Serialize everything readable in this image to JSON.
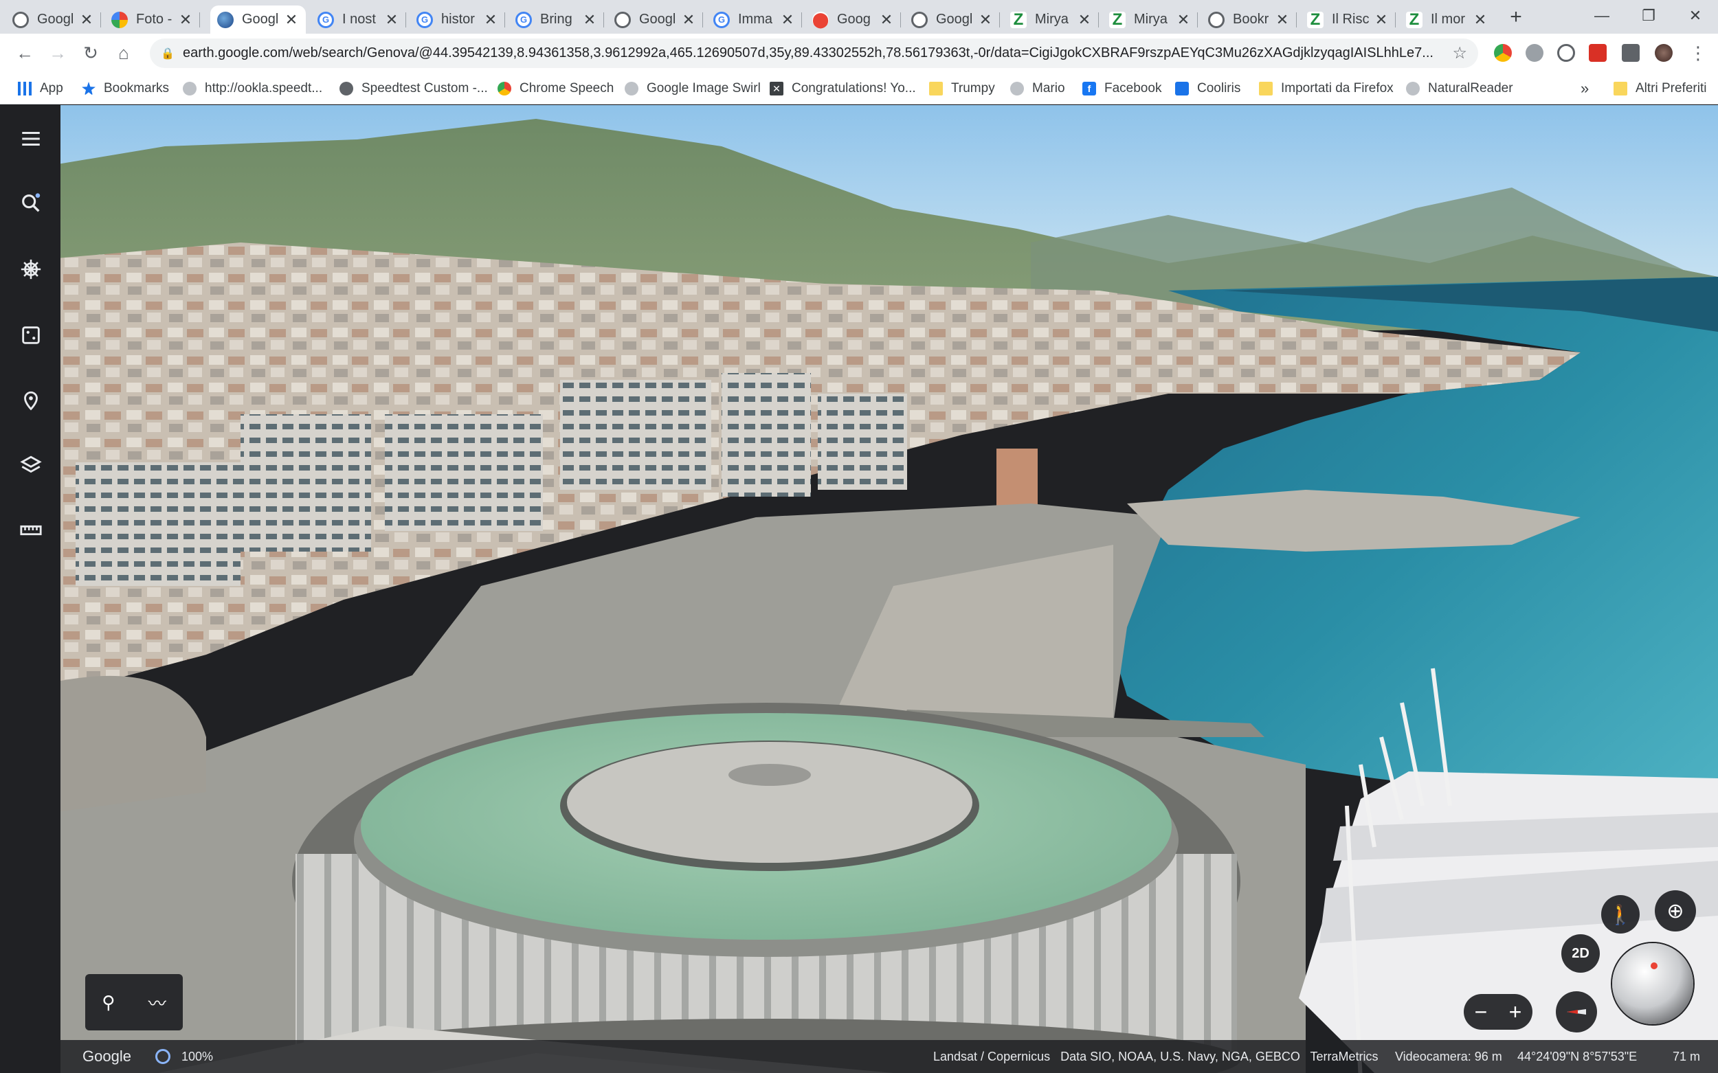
{
  "tabs": [
    {
      "title": "Googl",
      "icon": "google-icon",
      "active": false
    },
    {
      "title": "Foto -",
      "icon": "google-photos-icon",
      "active": false
    },
    {
      "title": "Googl",
      "icon": "google-earth-icon",
      "active": true
    },
    {
      "title": "I nost",
      "icon": "google-icon",
      "active": false
    },
    {
      "title": "histor",
      "icon": "google-icon",
      "active": false
    },
    {
      "title": "Bring",
      "icon": "google-icon",
      "active": false
    },
    {
      "title": "Googl",
      "icon": "globe-icon",
      "active": false
    },
    {
      "title": "Imma",
      "icon": "google-icon",
      "active": false
    },
    {
      "title": "Goog",
      "icon": "google-maps-icon",
      "active": false
    },
    {
      "title": "Googl",
      "icon": "globe-icon",
      "active": false
    },
    {
      "title": "Mirya",
      "icon": "miryam-icon",
      "active": false
    },
    {
      "title": "Mirya",
      "icon": "miryam-icon",
      "active": false
    },
    {
      "title": "Bookr",
      "icon": "globe-icon",
      "active": false
    },
    {
      "title": "Il Risc",
      "icon": "miryam-icon",
      "active": false
    },
    {
      "title": "Il mor",
      "icon": "miryam-icon",
      "active": false
    }
  ],
  "url": "earth.google.com/web/search/Genova/@44.39542139,8.94361358,3.9612992a,465.12690507d,35y,89.43302552h,78.56179363t,-0r/data=CigiJgokCXBRAF9rszpAEYqC3Mu26zXAGdjklzyqagIAISLhhLe7...",
  "bookmarks": [
    {
      "label": "App",
      "icon": "apps-grid-icon"
    },
    {
      "label": "Bookmarks",
      "icon": "bookmarks-star-icon"
    },
    {
      "label": "http://ookla.speedt...",
      "icon": "globe-icon"
    },
    {
      "label": "Speedtest Custom -...",
      "icon": "speedtest-icon"
    },
    {
      "label": "Chrome Speech",
      "icon": "chrome-icon"
    },
    {
      "label": "Google Image Swirl",
      "icon": "globe-icon"
    },
    {
      "label": "Congratulations! Yo...",
      "icon": "x-icon"
    },
    {
      "label": "Trumpy",
      "icon": "folder-icon"
    },
    {
      "label": "Mario",
      "icon": "globe-icon"
    },
    {
      "label": "Facebook",
      "icon": "facebook-icon"
    },
    {
      "label": "Cooliris",
      "icon": "cooliris-icon"
    },
    {
      "label": "Importati da Firefox",
      "icon": "folder-icon"
    },
    {
      "label": "NaturalReader",
      "icon": "globe-icon"
    }
  ],
  "bookmarks_more": "»",
  "other_bookmarks": "Altri Preferiti",
  "earth": {
    "view_mode": "2D",
    "google_label": "Google",
    "loading_percent": "100%",
    "attribution": "Landsat / Copernicus   Data SIO, NOAA, U.S. Navy, NGA, GEBCO   TerraMetrics",
    "camera": "Videocamera: 96 m",
    "coordinates": "44°24'09\"N 8°57'53\"E",
    "scale": "71 m"
  },
  "colors": {
    "accent": "#4285f4",
    "rail": "#202124",
    "dome": "#8fc2a5",
    "sea": "#2a8ea6"
  }
}
